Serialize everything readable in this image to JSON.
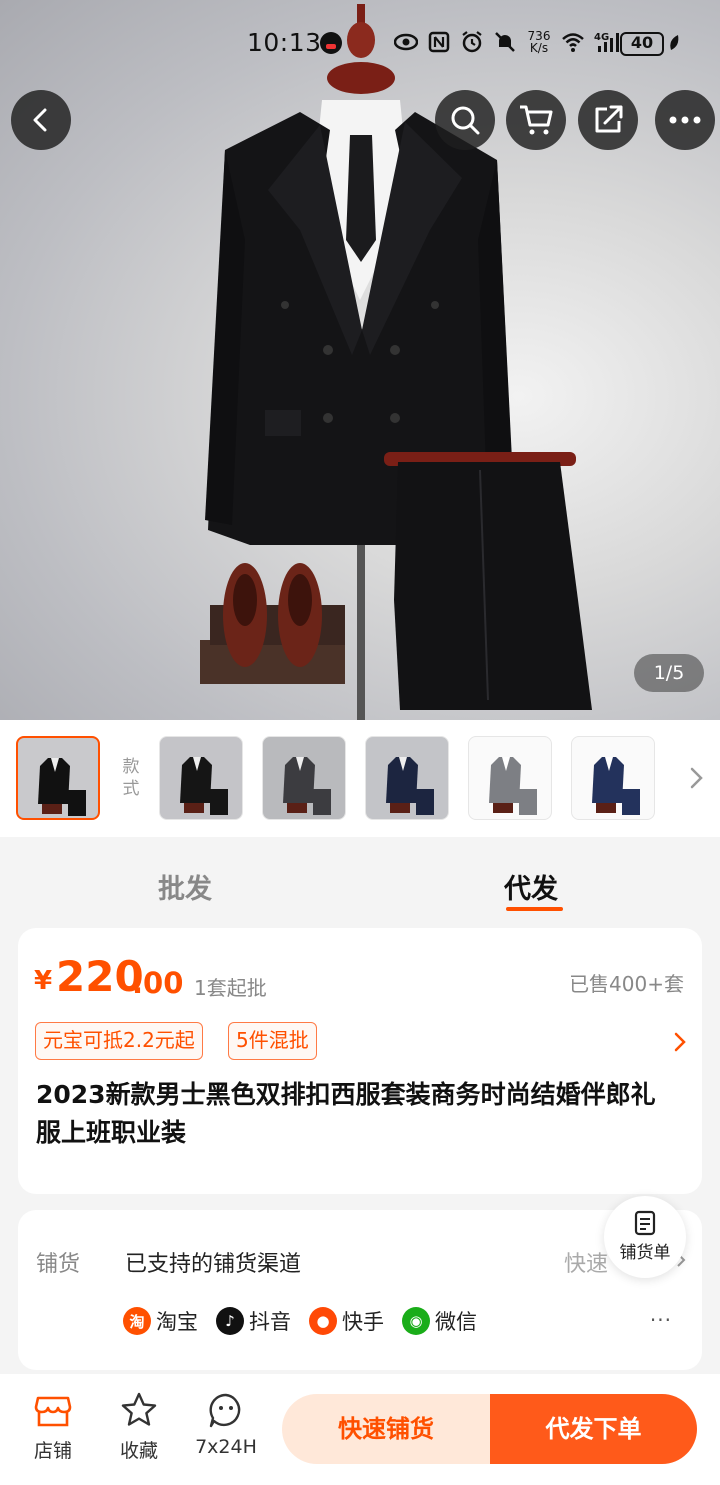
{
  "status_bar": {
    "time": "10:13",
    "network_speed_value": "736",
    "network_speed_unit": "K/s",
    "battery": "40"
  },
  "gallery": {
    "counter": "1/5",
    "variant_label": "款式"
  },
  "tabs": {
    "wholesale": "批发",
    "dropship": "代发",
    "active": "dropship"
  },
  "price": {
    "currency": "¥",
    "integer": "220",
    "decimal": ".00",
    "min_order": "1套起批",
    "sold": "已售400+套"
  },
  "promo_tags": [
    "元宝可抵2.2元起",
    "5件混批"
  ],
  "product_title": "2023新款男士黑色双排扣西服套装商务时尚结婚伴郎礼服上班职业装",
  "distribution": {
    "label": "铺货",
    "channels_text": "已支持的铺货渠道",
    "quick_text": "快速",
    "platforms": [
      {
        "name": "淘宝",
        "icon": "taobao-icon",
        "glyph": "淘",
        "color": "#ff5000"
      },
      {
        "name": "抖音",
        "icon": "douyin-icon",
        "glyph": "♪",
        "color": "#111111"
      },
      {
        "name": "快手",
        "icon": "kuaishou-icon",
        "glyph": "●",
        "color": "#ff4906"
      },
      {
        "name": "微信",
        "icon": "wechat-icon",
        "glyph": "◉",
        "color": "#1aad19"
      }
    ],
    "more": "···"
  },
  "fab": {
    "label": "铺货单"
  },
  "bottom_bar": {
    "store": "店铺",
    "favorite": "收藏",
    "service": "7x24H",
    "quick_distribute": "快速铺货",
    "dropship_order": "代发下单"
  },
  "colors": {
    "accent": "#ff5000",
    "quick_btn_bg": "#ffe8d9",
    "order_btn_bg": "#ff5a1a"
  }
}
